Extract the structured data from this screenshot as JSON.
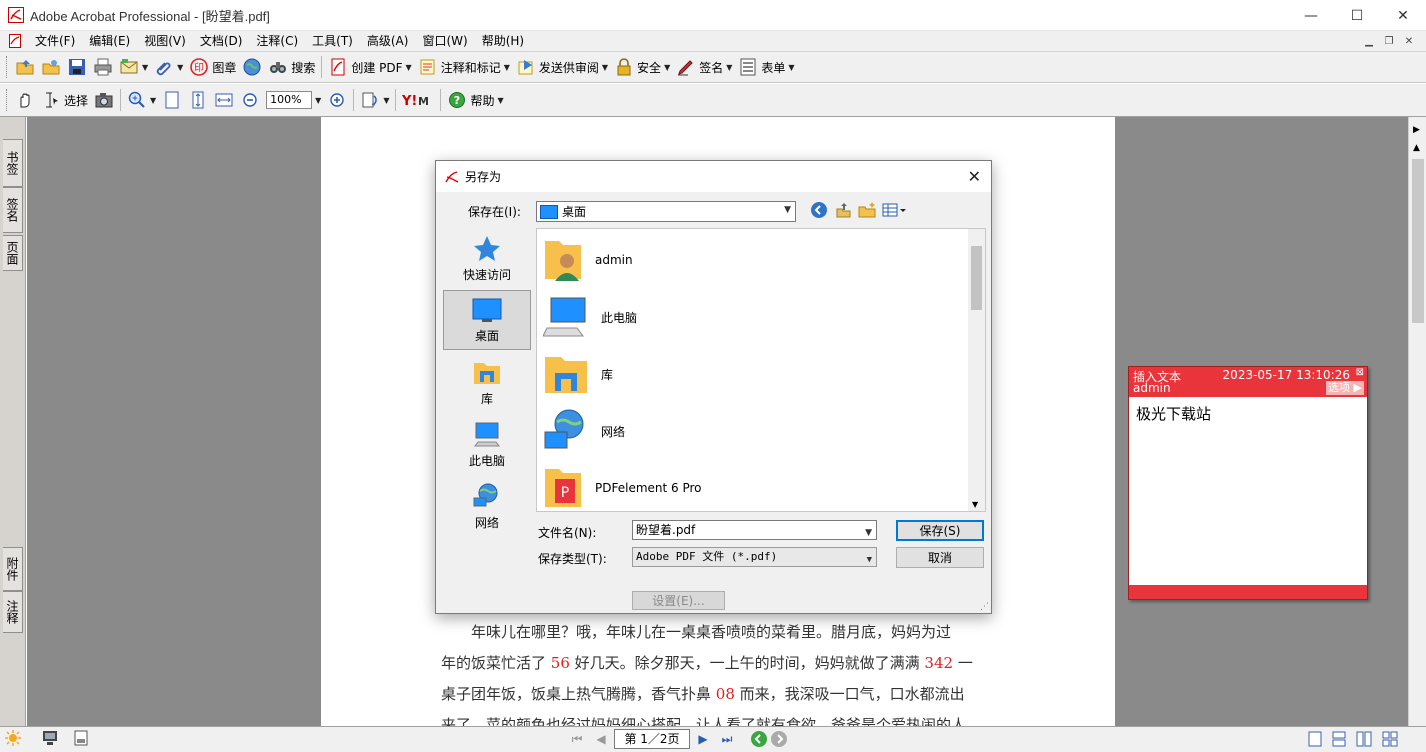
{
  "window": {
    "title": "Adobe Acrobat Professional - [盼望着.pdf]",
    "minimize": "—",
    "maximize": "☐",
    "close": "✕"
  },
  "menu": [
    "文件(F)",
    "编辑(E)",
    "视图(V)",
    "文档(D)",
    "注释(C)",
    "工具(T)",
    "高级(A)",
    "窗口(W)",
    "帮助(H)"
  ],
  "toolbar1": {
    "stamp": "图章",
    "search": "搜索",
    "create_pdf": "创建 PDF",
    "comment_markup": "注释和标记",
    "send_review": "发送供审阅",
    "security": "安全",
    "sign": "签名",
    "forms": "表单"
  },
  "toolbar2": {
    "select": "选择",
    "zoom": "100%",
    "help": "帮助"
  },
  "side_tabs": {
    "bookmarks": "书签",
    "signatures": "签名",
    "pages": "页面",
    "attachments": "附件",
    "comments": "注释"
  },
  "document": {
    "lines": [
      {
        "parts": [
          {
            "t": "年味儿在哪里？哦，年味儿在一桌桌香喷喷的菜肴里。腊月底，妈妈为过",
            "red": false
          }
        ]
      },
      {
        "parts": [
          {
            "t": "年的饭菜忙活了 ",
            "red": false
          },
          {
            "t": "56",
            "red": true
          },
          {
            "t": " 好几天。除夕那天，一上午的时间，妈妈就做了满满 ",
            "red": false
          },
          {
            "t": "342",
            "red": true
          },
          {
            "t": " 一",
            "red": false
          }
        ]
      },
      {
        "parts": [
          {
            "t": "桌子团年饭，饭桌上热气腾腾，香气扑鼻 ",
            "red": false
          },
          {
            "t": "08",
            "red": true
          },
          {
            "t": " 而来，我深吸一口气，口水都流出",
            "red": false
          }
        ]
      },
      {
        "parts": [
          {
            "t": "来了。菜的颜色也经过妈妈细心搭配，让人看了就有食欲。爸爸是个爱热闹的人",
            "red": false
          }
        ]
      }
    ]
  },
  "status": {
    "page_field": "第 1／2页"
  },
  "popup": {
    "type": "插入文本",
    "author": "admin",
    "date": "2023-05-17 13:10:26",
    "options": "选项",
    "close": "⊠",
    "text": "极光下载站"
  },
  "dialog": {
    "title": "另存为",
    "save_in_label": "保存在(I):",
    "save_in_value": "桌面",
    "places": [
      "快速访问",
      "桌面",
      "库",
      "此电脑",
      "网络"
    ],
    "files": [
      "admin",
      "此电脑",
      "库",
      "网络",
      "PDFelement 6 Pro"
    ],
    "filename_label": "文件名(N):",
    "filename_value": "盼望着.pdf",
    "filetype_label": "保存类型(T):",
    "filetype_value": "Adobe PDF 文件 (*.pdf)",
    "save_button": "保存(S)",
    "cancel_button": "取消",
    "settings_button": "设置(E)..."
  },
  "colors": {
    "popup_red": "#e8343a",
    "accent_blue": "#0078d7"
  }
}
